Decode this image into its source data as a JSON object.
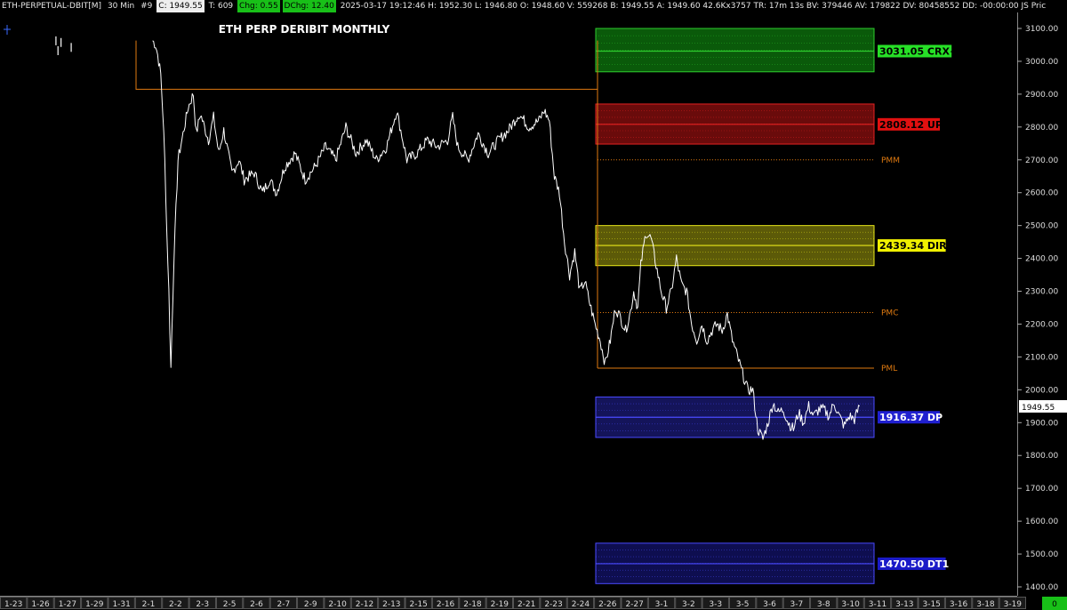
{
  "header": {
    "symbol": "ETH-PERPETUAL-DBIT[M]",
    "interval": "30 Min",
    "tag": "#9",
    "close": "C: 1949.55",
    "trades": "T: 609",
    "chg": "Chg: 0.55",
    "dchg": "DChg: 12.40",
    "stats": "2025-03-17 19:12:46 H: 1952.30 L: 1946.80 O: 1948.60 V: 559268 B: 1949.55 A: 1949.60 42.6Kx3757 TR: 17m 13s BV: 379446 AV: 179822 DV: 80458552 DD: -00:00:00 JS Pric"
  },
  "chart_data": {
    "type": "line",
    "title": "ETH PERP DERIBIT MONTHLY",
    "ylim": [
      1375,
      3120
    ],
    "y_ticks": [
      1400,
      1500,
      1600,
      1700,
      1800,
      1900,
      2000,
      2100,
      2200,
      2300,
      2400,
      2500,
      2600,
      2700,
      2800,
      2900,
      3000,
      3100
    ],
    "y_tick_labels": [
      "1400.00",
      "1500.00",
      "1600.00",
      "1700.00",
      "1800.00",
      "1900.00",
      "2000.00",
      "2100.00",
      "2200.00",
      "2300.00",
      "2400.00",
      "2500.00",
      "2600.00",
      "2700.00",
      "2800.00",
      "2900.00",
      "3000.00",
      "3100.00"
    ],
    "x_tick_labels": [
      "1-23",
      "1-26",
      "1-27",
      "1-29",
      "1-31",
      "2-1",
      "2-2",
      "2-3",
      "2-5",
      "2-6",
      "2-7",
      "2-9",
      "2-10",
      "2-12",
      "2-13",
      "2-15",
      "2-16",
      "2-18",
      "2-19",
      "2-21",
      "2-23",
      "2-24",
      "2-26",
      "2-27",
      "3-1",
      "3-2",
      "3-3",
      "3-5",
      "3-6",
      "3-7",
      "3-8",
      "3-10",
      "3-11",
      "3-13",
      "3-15",
      "3-16",
      "3-18",
      "3-19"
    ],
    "last_price": 1949.55,
    "last_price_label": "1949.55",
    "corner_value": "0",
    "price_series": [
      [
        0.055,
        3065
      ],
      [
        0.057,
        3035
      ],
      [
        0.06,
        3060
      ],
      [
        0.07,
        3045
      ],
      [
        0.15,
        3063
      ],
      [
        0.153,
        3050
      ],
      [
        0.155,
        3020
      ],
      [
        0.158,
        2960
      ],
      [
        0.16,
        2850
      ],
      [
        0.162,
        2700
      ],
      [
        0.164,
        2480
      ],
      [
        0.166,
        2300
      ],
      [
        0.168,
        2066
      ],
      [
        0.171,
        2400
      ],
      [
        0.175,
        2700
      ],
      [
        0.18,
        2780
      ],
      [
        0.185,
        2860
      ],
      [
        0.19,
        2900
      ],
      [
        0.193,
        2780
      ],
      [
        0.197,
        2840
      ],
      [
        0.205,
        2760
      ],
      [
        0.21,
        2830
      ],
      [
        0.215,
        2720
      ],
      [
        0.22,
        2790
      ],
      [
        0.228,
        2660
      ],
      [
        0.235,
        2700
      ],
      [
        0.24,
        2640
      ],
      [
        0.25,
        2660
      ],
      [
        0.258,
        2600
      ],
      [
        0.265,
        2640
      ],
      [
        0.272,
        2600
      ],
      [
        0.28,
        2680
      ],
      [
        0.29,
        2720
      ],
      [
        0.3,
        2640
      ],
      [
        0.31,
        2680
      ],
      [
        0.32,
        2740
      ],
      [
        0.33,
        2700
      ],
      [
        0.34,
        2800
      ],
      [
        0.35,
        2720
      ],
      [
        0.36,
        2760
      ],
      [
        0.37,
        2700
      ],
      [
        0.38,
        2740
      ],
      [
        0.39,
        2850
      ],
      [
        0.4,
        2700
      ],
      [
        0.41,
        2720
      ],
      [
        0.42,
        2760
      ],
      [
        0.43,
        2740
      ],
      [
        0.44,
        2760
      ],
      [
        0.445,
        2830
      ],
      [
        0.45,
        2740
      ],
      [
        0.46,
        2700
      ],
      [
        0.47,
        2780
      ],
      [
        0.48,
        2720
      ],
      [
        0.49,
        2760
      ],
      [
        0.5,
        2790
      ],
      [
        0.51,
        2840
      ],
      [
        0.52,
        2800
      ],
      [
        0.53,
        2820
      ],
      [
        0.535,
        2850
      ],
      [
        0.54,
        2820
      ],
      [
        0.545,
        2650
      ],
      [
        0.55,
        2600
      ],
      [
        0.555,
        2450
      ],
      [
        0.56,
        2350
      ],
      [
        0.565,
        2420
      ],
      [
        0.57,
        2300
      ],
      [
        0.575,
        2330
      ],
      [
        0.58,
        2260
      ],
      [
        0.585,
        2200
      ],
      [
        0.59,
        2150
      ],
      [
        0.595,
        2080
      ],
      [
        0.6,
        2150
      ],
      [
        0.605,
        2250
      ],
      [
        0.61,
        2220
      ],
      [
        0.615,
        2180
      ],
      [
        0.62,
        2240
      ],
      [
        0.623,
        2300
      ],
      [
        0.627,
        2250
      ],
      [
        0.63,
        2380
      ],
      [
        0.635,
        2480
      ],
      [
        0.64,
        2460
      ],
      [
        0.645,
        2380
      ],
      [
        0.65,
        2300
      ],
      [
        0.655,
        2250
      ],
      [
        0.66,
        2300
      ],
      [
        0.665,
        2400
      ],
      [
        0.67,
        2320
      ],
      [
        0.675,
        2300
      ],
      [
        0.68,
        2200
      ],
      [
        0.685,
        2150
      ],
      [
        0.69,
        2200
      ],
      [
        0.695,
        2150
      ],
      [
        0.7,
        2180
      ],
      [
        0.705,
        2200
      ],
      [
        0.71,
        2180
      ],
      [
        0.715,
        2230
      ],
      [
        0.72,
        2150
      ],
      [
        0.725,
        2100
      ],
      [
        0.73,
        2050
      ],
      [
        0.735,
        2000
      ],
      [
        0.74,
        2000
      ],
      [
        0.745,
        1880
      ],
      [
        0.75,
        1850
      ],
      [
        0.755,
        1900
      ],
      [
        0.76,
        1960
      ],
      [
        0.765,
        1930
      ],
      [
        0.77,
        1940
      ],
      [
        0.775,
        1900
      ],
      [
        0.78,
        1880
      ],
      [
        0.785,
        1930
      ],
      [
        0.79,
        1900
      ],
      [
        0.795,
        1950
      ],
      [
        0.8,
        1920
      ],
      [
        0.805,
        1940
      ],
      [
        0.81,
        1940
      ],
      [
        0.815,
        1920
      ],
      [
        0.82,
        1960
      ],
      [
        0.825,
        1920
      ],
      [
        0.83,
        1890
      ],
      [
        0.835,
        1920
      ],
      [
        0.84,
        1910
      ],
      [
        0.845,
        1950
      ]
    ],
    "levels": [
      {
        "name": "CRX+",
        "value": 3031.05,
        "label": "3031.05 CRX+",
        "band": [
          2968,
          3100
        ],
        "fill": "#0a5a0a",
        "line": "#2ecc2e",
        "label_bg": "#27e027",
        "label_fg": "#000000"
      },
      {
        "name": "UP",
        "value": 2808.12,
        "label": "2808.12 UP",
        "band": [
          2748,
          2870
        ],
        "fill": "#6a0b0b",
        "line": "#e52222",
        "label_bg": "#e01010",
        "label_fg": "#000000"
      },
      {
        "name": "DIR",
        "value": 2439.34,
        "label": "2439.34 DIR",
        "band": [
          2378,
          2500
        ],
        "fill": "#5c5a08",
        "line": "#e8e81a",
        "label_bg": "#f0f000",
        "label_fg": "#000000"
      },
      {
        "name": "DP",
        "value": 1916.37,
        "label": "1916.37 DP",
        "band": [
          1855,
          1978
        ],
        "fill": "#14145a",
        "line": "#4a4aff",
        "label_bg": "#2020d0",
        "label_fg": "#ffffff"
      },
      {
        "name": "DT1",
        "value": 1470.5,
        "label": "1470.50 DT1",
        "band": [
          1410,
          1533
        ],
        "fill": "#0e0e50",
        "line": "#4a4aff",
        "label_bg": "#1a1ac8",
        "label_fg": "#ffffff"
      }
    ],
    "ref_levels": [
      {
        "name": "PMM",
        "value": 2700,
        "label": "PMM",
        "color": "#e07a10",
        "style": "dotted"
      },
      {
        "name": "PMC",
        "value": 2235,
        "label": "PMC",
        "color": "#e07a10",
        "style": "dotted"
      },
      {
        "name": "PML",
        "value": 2066,
        "label": "PML",
        "color": "#e07a10",
        "style": "solid"
      }
    ],
    "prev_month": {
      "high": 2915,
      "low": 2066,
      "color": "#e07a10"
    },
    "colors": {
      "background": "#000000",
      "price": "#ffffff",
      "axis_text": "#dddddd",
      "grid": "#222222"
    }
  }
}
